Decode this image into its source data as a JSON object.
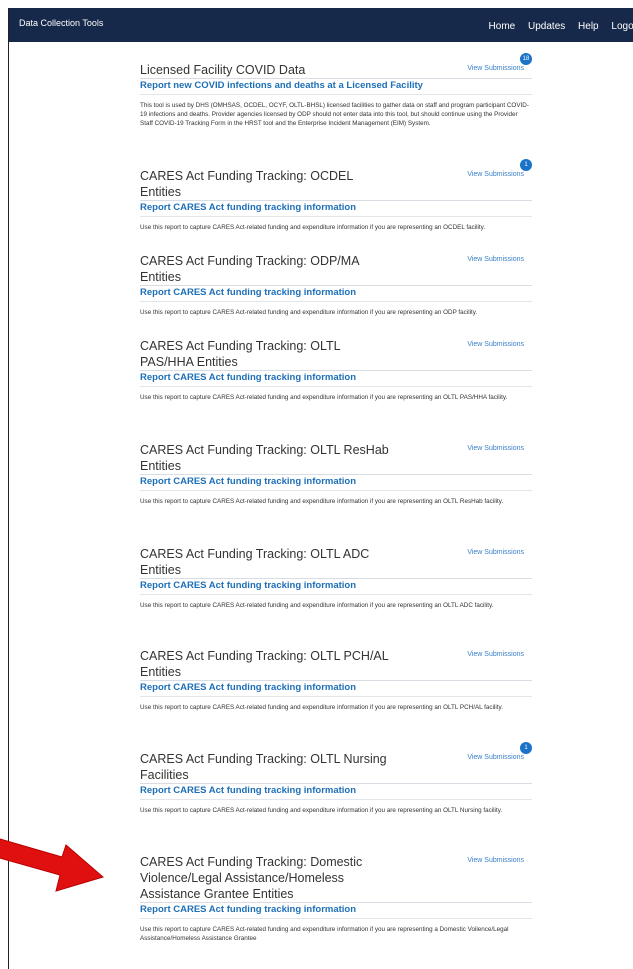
{
  "navbar": {
    "brand": "Data Collection Tools",
    "links": [
      "Home",
      "Updates",
      "Help",
      "Logout"
    ]
  },
  "view_submissions_label": "View Submissions",
  "sections": [
    {
      "title": "Licensed Facility COVID Data",
      "badge": "18",
      "link": "Report new COVID infections and deaths at a Licensed Facility",
      "desc": "This tool is used by DHS (OMHSAS, OCDEL, OCYF, OLTL-BHSL) licensed facilities to gather data on staff and program participant COVID-19 infections and deaths. Provider agencies licensed by ODP should not enter data into this tool, but should continue using the Provider Staff COVID-19 Tracking Form in the HRST tool and the Enterprise Incident Management (EIM) System."
    },
    {
      "title": "CARES Act Funding Tracking: OCDEL Entities",
      "badge": "1",
      "link": "Report CARES Act funding tracking information",
      "desc": "Use this report to capture CARES Act-related funding and expenditure information if you are representing an OCDEL facility."
    },
    {
      "title": "CARES Act Funding Tracking: ODP/MA Entities",
      "badge": "",
      "link": "Report CARES Act funding tracking information",
      "desc": "Use this report to capture CARES Act-related funding and expenditure information if you are representing an ODP facility."
    },
    {
      "title": "CARES Act Funding Tracking: OLTL PAS/HHA Entities",
      "badge": "",
      "link": "Report CARES Act funding tracking information",
      "desc": "Use this report to capture CARES Act-related funding and expenditure information if you are representing an OLTL PAS/HHA facility."
    },
    {
      "title": "CARES Act Funding Tracking: OLTL ResHab Entities",
      "badge": "",
      "link": "Report CARES Act funding tracking information",
      "desc": "Use this report to capture CARES Act-related funding and expenditure information if you are representing an OLTL ResHab facility."
    },
    {
      "title": "CARES Act Funding Tracking: OLTL ADC Entities",
      "badge": "",
      "link": "Report CARES Act funding tracking information",
      "desc": "Use this report to capture CARES Act-related funding and expenditure information if you are representing an OLTL ADC facility."
    },
    {
      "title": "CARES Act Funding Tracking: OLTL PCH/AL Entities",
      "badge": "",
      "link": "Report CARES Act funding tracking information",
      "desc": "Use this report to capture CARES Act-related funding and expenditure information if you are representing an OLTL PCH/AL facility."
    },
    {
      "title": "CARES Act Funding Tracking: OLTL Nursing Facilities",
      "badge": "1",
      "link": "Report CARES Act funding tracking information",
      "desc": "Use this report to capture CARES Act-related funding and expenditure information if you are representing an OLTL Nursing facility."
    },
    {
      "title": "CARES Act Funding Tracking: Domestic Violence/Legal Assistance/Homeless Assistance Grantee Entities",
      "badge": "",
      "link": "Report CARES Act funding tracking information",
      "desc": "Use this report to capture CARES Act-related funding and expenditure information if you are representing a Domestic Voilence/Legal Assistance/Homeless Assistance Grantee"
    }
  ],
  "colors": {
    "navbar": "#17294a",
    "link": "#1d6fb8",
    "badge": "#1a73c8",
    "arrow": "#e01010"
  }
}
